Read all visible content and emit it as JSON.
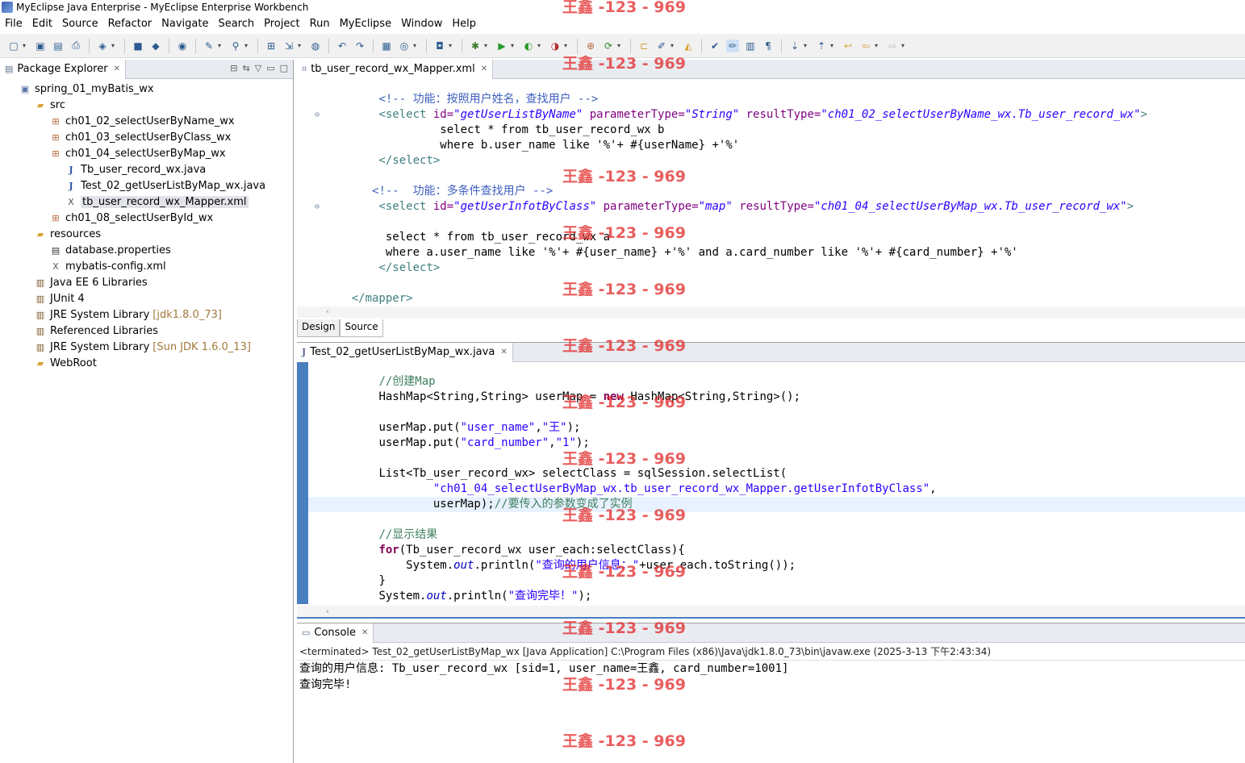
{
  "window": {
    "title": "MyEclipse Java Enterprise - MyEclipse Enterprise Workbench"
  },
  "menu": [
    "File",
    "Edit",
    "Source",
    "Refactor",
    "Navigate",
    "Search",
    "Project",
    "Run",
    "MyEclipse",
    "Window",
    "Help"
  ],
  "package_explorer": {
    "title": "Package Explorer",
    "tree": [
      {
        "label": "spring_01_myBatis_wx",
        "icon": "project-icon",
        "depth": 0
      },
      {
        "label": "src",
        "icon": "source-folder-icon",
        "depth": 1
      },
      {
        "label": "ch01_02_selectUserByName_wx",
        "icon": "package-icon",
        "depth": 2
      },
      {
        "label": "ch01_03_selectUserByClass_wx",
        "icon": "package-icon",
        "depth": 2
      },
      {
        "label": "ch01_04_selectUserByMap_wx",
        "icon": "package-icon",
        "depth": 2
      },
      {
        "label": "Tb_user_record_wx.java",
        "icon": "java-file-icon",
        "depth": 3
      },
      {
        "label": "Test_02_getUserListByMap_wx.java",
        "icon": "java-file-icon",
        "depth": 3
      },
      {
        "label": "tb_user_record_wx_Mapper.xml",
        "icon": "xml-file-icon",
        "depth": 3,
        "selected": true
      },
      {
        "label": "ch01_08_selectUserById_wx",
        "icon": "package-icon",
        "depth": 2
      },
      {
        "label": "resources",
        "icon": "source-folder-icon",
        "depth": 1
      },
      {
        "label": "database.properties",
        "icon": "properties-file-icon",
        "depth": 2
      },
      {
        "label": "mybatis-config.xml",
        "icon": "xml-file-icon",
        "depth": 2
      },
      {
        "label": "Java EE 6 Libraries",
        "icon": "library-icon",
        "depth": 1
      },
      {
        "label": "JUnit 4",
        "icon": "library-icon",
        "depth": 1
      },
      {
        "label": "JRE System Library",
        "decor": "[jdk1.8.0_73]",
        "icon": "library-icon",
        "depth": 1
      },
      {
        "label": "Referenced Libraries",
        "icon": "library-icon",
        "depth": 1
      },
      {
        "label": "JRE System Library",
        "decor": "[Sun JDK 1.6.0_13]",
        "icon": "library-icon",
        "depth": 1
      },
      {
        "label": "WebRoot",
        "icon": "folder-icon",
        "depth": 1
      }
    ]
  },
  "editor_xml": {
    "tab_label": "tb_user_record_wx_Mapper.xml",
    "mode_tabs": [
      "Design",
      "Source"
    ],
    "lines": [
      {
        "indent": "        ",
        "parts": [
          {
            "t": "<!--",
            "c": "c-cmt"
          },
          {
            "t": " 功能：按照用户姓名，查找用户 ",
            "c": "c-cmt"
          },
          {
            "t": "-->",
            "c": "c-cmt"
          }
        ]
      },
      {
        "indent": "        ",
        "fold": true,
        "parts": [
          {
            "t": "<select ",
            "c": "c-tag"
          },
          {
            "t": "id=",
            "c": "c-attr"
          },
          {
            "t": "\"getUserListByName\"",
            "c": "c-str"
          },
          {
            "t": " parameterType=",
            "c": "c-attr"
          },
          {
            "t": "\"String\"",
            "c": "c-str"
          },
          {
            "t": " resultType=",
            "c": "c-attr"
          },
          {
            "t": "\"ch01_02_selectUserByName_wx.Tb_user_record_wx\"",
            "c": "c-str"
          },
          {
            "t": ">",
            "c": "c-tag"
          }
        ]
      },
      {
        "indent": "                 ",
        "parts": [
          {
            "t": "select * from tb_user_record_wx b",
            "c": "c-text"
          }
        ]
      },
      {
        "indent": "                 ",
        "parts": [
          {
            "t": "where b.user_name like '%'+ #{userName} +'%'",
            "c": "c-text"
          }
        ]
      },
      {
        "indent": "        ",
        "parts": [
          {
            "t": "</select>",
            "c": "c-tag"
          }
        ]
      },
      {
        "indent": "",
        "parts": []
      },
      {
        "indent": "       ",
        "parts": [
          {
            "t": "<!--",
            "c": "c-cmt"
          },
          {
            "t": "  功能：多条件查找用户 ",
            "c": "c-cmt"
          },
          {
            "t": "-->",
            "c": "c-cmt"
          }
        ]
      },
      {
        "indent": "        ",
        "fold": true,
        "parts": [
          {
            "t": "<select ",
            "c": "c-tag"
          },
          {
            "t": "id=",
            "c": "c-attr"
          },
          {
            "t": "\"getUserInfotByClass\"",
            "c": "c-str"
          },
          {
            "t": " parameterType=",
            "c": "c-attr"
          },
          {
            "t": "\"map\"",
            "c": "c-str"
          },
          {
            "t": " resultType=",
            "c": "c-attr"
          },
          {
            "t": "\"ch01_04_selectUserByMap_wx.Tb_user_record_wx\"",
            "c": "c-str"
          },
          {
            "t": ">",
            "c": "c-tag"
          }
        ]
      },
      {
        "indent": "",
        "parts": []
      },
      {
        "indent": "         ",
        "parts": [
          {
            "t": "select * from tb_user_record_wx a",
            "c": "c-text"
          }
        ]
      },
      {
        "indent": "         ",
        "parts": [
          {
            "t": "where a.user_name like '%'+ #{user_name} +'%' and a.card_number like '%'+ #{card_number} +'%'",
            "c": "c-text"
          }
        ]
      },
      {
        "indent": "        ",
        "parts": [
          {
            "t": "</select>",
            "c": "c-tag"
          }
        ]
      },
      {
        "indent": "",
        "parts": []
      },
      {
        "indent": "    ",
        "parts": [
          {
            "t": "</mapper>",
            "c": "c-tag"
          }
        ]
      }
    ]
  },
  "editor_java": {
    "tab_label": "Test_02_getUserListByMap_wx.java",
    "lines": [
      {
        "indent": "        ",
        "parts": [
          {
            "t": "//创建Map",
            "c": "j-cmt"
          }
        ]
      },
      {
        "indent": "        ",
        "parts": [
          {
            "t": "HashMap<String,String> userMap = ",
            "c": "c-text"
          },
          {
            "t": "new",
            "c": "j-kw"
          },
          {
            "t": " HashMap<String,String>();",
            "c": "c-text"
          }
        ]
      },
      {
        "indent": "",
        "parts": []
      },
      {
        "indent": "        ",
        "parts": [
          {
            "t": "userMap.put(",
            "c": "c-text"
          },
          {
            "t": "\"user_name\"",
            "c": "j-str"
          },
          {
            "t": ",",
            "c": "c-text"
          },
          {
            "t": "\"王\"",
            "c": "j-str"
          },
          {
            "t": ");",
            "c": "c-text"
          }
        ]
      },
      {
        "indent": "        ",
        "parts": [
          {
            "t": "userMap.put(",
            "c": "c-text"
          },
          {
            "t": "\"card_number\"",
            "c": "j-str"
          },
          {
            "t": ",",
            "c": "c-text"
          },
          {
            "t": "\"1\"",
            "c": "j-str"
          },
          {
            "t": ");",
            "c": "c-text"
          }
        ]
      },
      {
        "indent": "",
        "parts": []
      },
      {
        "indent": "        ",
        "parts": [
          {
            "t": "List<Tb_user_record_wx> selectClass = sqlSession.selectList(",
            "c": "c-text"
          }
        ]
      },
      {
        "indent": "                ",
        "parts": [
          {
            "t": "\"ch01_04_selectUserByMap_wx.tb_user_record_wx_Mapper.getUserInfotByClass\"",
            "c": "j-str"
          },
          {
            "t": ",",
            "c": "c-text"
          }
        ]
      },
      {
        "indent": "                ",
        "highlight": true,
        "parts": [
          {
            "t": "userMap);",
            "c": "c-text"
          },
          {
            "t": "//要传入的参数变成了实例",
            "c": "j-cmt"
          }
        ]
      },
      {
        "indent": "",
        "parts": []
      },
      {
        "indent": "        ",
        "parts": [
          {
            "t": "//显示结果",
            "c": "j-cmt"
          }
        ]
      },
      {
        "indent": "        ",
        "parts": [
          {
            "t": "for",
            "c": "j-kw"
          },
          {
            "t": "(Tb_user_record_wx user_each:selectClass){",
            "c": "c-text"
          }
        ]
      },
      {
        "indent": "            ",
        "parts": [
          {
            "t": "System.",
            "c": "c-text"
          },
          {
            "t": "out",
            "c": "j-field"
          },
          {
            "t": ".println(",
            "c": "c-text"
          },
          {
            "t": "\"查询的用户信息：\"",
            "c": "j-str"
          },
          {
            "t": "+user_each.toString());",
            "c": "c-text"
          }
        ]
      },
      {
        "indent": "        ",
        "parts": [
          {
            "t": "}",
            "c": "c-text"
          }
        ]
      },
      {
        "indent": "        ",
        "parts": [
          {
            "t": "System.",
            "c": "c-text"
          },
          {
            "t": "out",
            "c": "j-field"
          },
          {
            "t": ".println(",
            "c": "c-text"
          },
          {
            "t": "\"查询完毕！\"",
            "c": "j-str"
          },
          {
            "t": ");",
            "c": "c-text"
          }
        ]
      }
    ]
  },
  "console": {
    "tab_label": "Console",
    "status": "<terminated> Test_02_getUserListByMap_wx [Java Application] C:\\Program Files (x86)\\Java\\jdk1.8.0_73\\bin\\javaw.exe (2025-3-13 下午2:43:34)",
    "output": [
      "查询的用户信息: Tb_user_record_wx [sid=1, user_name=王鑫, card_number=1001]",
      "查询完毕!"
    ]
  },
  "watermark": {
    "text": "王鑫 -123 - 969",
    "rows": [
      0,
      70,
      210,
      280,
      350,
      420,
      490,
      560,
      630,
      700,
      770,
      840,
      910
    ]
  },
  "colors": {
    "accent": "#4a7fc0",
    "watermark": "#e12828"
  }
}
